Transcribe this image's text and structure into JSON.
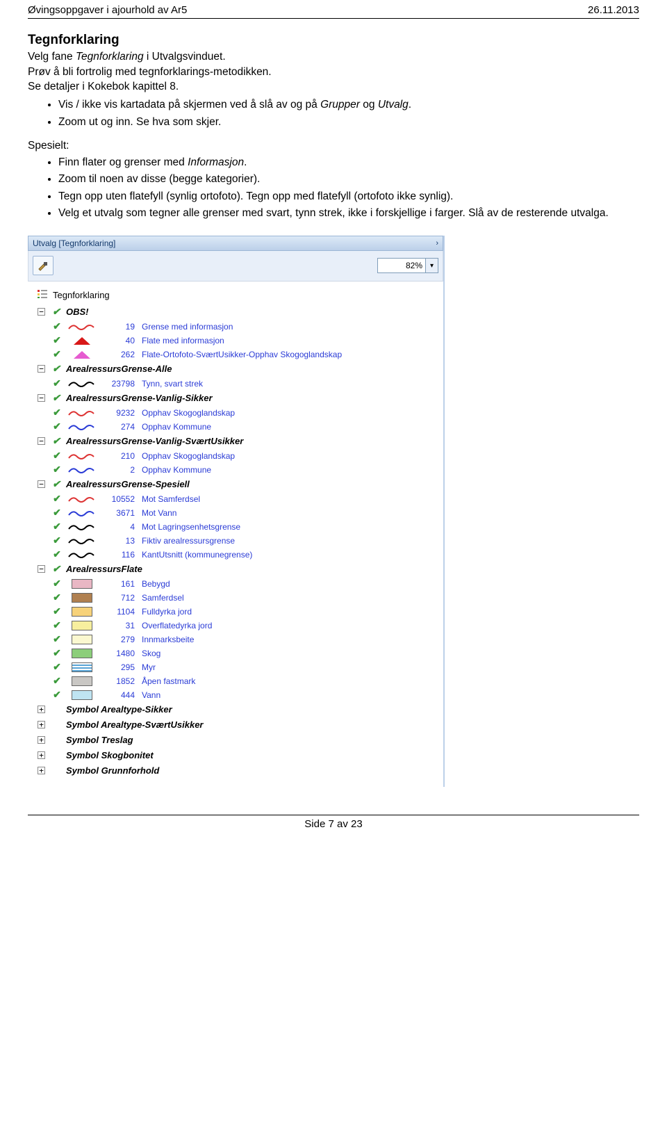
{
  "header": {
    "left": "Øvingsoppgaver i ajourhold av Ar5",
    "right": "26.11.2013"
  },
  "section": {
    "title": "Tegnforklaring",
    "line1_a": "Velg fane ",
    "line1_i": "Tegnforklaring",
    "line1_b": " i Utvalgsvinduet.",
    "line2": "Prøv å bli fortrolig med tegnforklarings-metodikken.",
    "line3": "Se detaljer i Kokebok kapittel 8."
  },
  "bullets1": {
    "b1_a": "Vis / ikke vis kartadata på skjermen ved å slå av og på ",
    "b1_i": "Grupper",
    "b1_b": " og ",
    "b1_i2": "Utvalg",
    "b1_c": ".",
    "b2": "Zoom ut og inn. Se hva som skjer."
  },
  "spesielt": "Spesielt:",
  "bullets2": {
    "b1_a": "Finn flater og grenser med ",
    "b1_i": "Informasjon",
    "b1_b": ".",
    "b2": "Zoom til noen av disse (begge kategorier).",
    "b3": "Tegn opp uten flatefyll (synlig ortofoto). Tegn opp med flatefyll (ortofoto ikke synlig).",
    "b4": "Velg et utvalg som tegner alle grenser med svart, tynn strek, ikke i forskjellige i farger. Slå av de resterende utvalga."
  },
  "ui": {
    "window_title": "Utvalg [Tegnforklaring]",
    "zoom": "82%",
    "legend_label": "Tegnforklaring",
    "groups": [
      {
        "name": "OBS!",
        "toggle": "−",
        "items": [
          {
            "num": "19",
            "label": "Grense med informasjon",
            "sym": {
              "type": "wave",
              "color": "#d33"
            }
          },
          {
            "num": "40",
            "label": "Flate med informasjon",
            "sym": {
              "type": "tri",
              "color": "#d81818"
            }
          },
          {
            "num": "262",
            "label": "Flate-Ortofoto-SværtUsikker-Opphav Skogoglandskap",
            "sym": {
              "type": "tri",
              "color": "#e65bd0"
            }
          }
        ]
      },
      {
        "name": "ArealressursGrense-Alle",
        "toggle": "−",
        "items": [
          {
            "num": "23798",
            "label": "Tynn, svart strek",
            "sym": {
              "type": "wave",
              "color": "#000"
            }
          }
        ]
      },
      {
        "name": "ArealressursGrense-Vanlig-Sikker",
        "toggle": "−",
        "items": [
          {
            "num": "9232",
            "label": "Opphav Skogoglandskap",
            "sym": {
              "type": "wave",
              "color": "#d33"
            }
          },
          {
            "num": "274",
            "label": "Opphav Kommune",
            "sym": {
              "type": "wave",
              "color": "#2a3bd6"
            }
          }
        ]
      },
      {
        "name": "ArealressursGrense-Vanlig-SværtUsikker",
        "toggle": "−",
        "items": [
          {
            "num": "210",
            "label": "Opphav Skogoglandskap",
            "sym": {
              "type": "wave",
              "color": "#d33"
            }
          },
          {
            "num": "2",
            "label": "Opphav Kommune",
            "sym": {
              "type": "wave",
              "color": "#2a3bd6"
            }
          }
        ]
      },
      {
        "name": "ArealressursGrense-Spesiell",
        "toggle": "−",
        "items": [
          {
            "num": "10552",
            "label": "Mot Samferdsel",
            "sym": {
              "type": "wave",
              "color": "#d33"
            }
          },
          {
            "num": "3671",
            "label": "Mot Vann",
            "sym": {
              "type": "wave",
              "color": "#2a3bd6"
            }
          },
          {
            "num": "4",
            "label": "Mot Lagringsenhetsgrense",
            "sym": {
              "type": "wave",
              "color": "#000"
            }
          },
          {
            "num": "13",
            "label": "Fiktiv arealressursgrense",
            "sym": {
              "type": "wave",
              "color": "#000"
            }
          },
          {
            "num": "116",
            "label": "KantUtsnitt (kommunegrense)",
            "sym": {
              "type": "wave",
              "color": "#000"
            }
          }
        ]
      },
      {
        "name": "ArealressursFlate",
        "toggle": "−",
        "items": [
          {
            "num": "161",
            "label": "Bebygd",
            "sym": {
              "type": "box",
              "color": "#e9b7c4"
            }
          },
          {
            "num": "712",
            "label": "Samferdsel",
            "sym": {
              "type": "box",
              "color": "#b08050"
            }
          },
          {
            "num": "1104",
            "label": "Fulldyrka jord",
            "sym": {
              "type": "box",
              "color": "#f7d27a"
            }
          },
          {
            "num": "31",
            "label": "Overflatedyrka jord",
            "sym": {
              "type": "box",
              "color": "#f7ef9e"
            }
          },
          {
            "num": "279",
            "label": "Innmarksbeite",
            "sym": {
              "type": "box",
              "color": "#fbf8d0"
            }
          },
          {
            "num": "1480",
            "label": "Skog",
            "sym": {
              "type": "box",
              "color": "#8cce7a"
            }
          },
          {
            "num": "295",
            "label": "Myr",
            "sym": {
              "type": "stripes",
              "color": ""
            }
          },
          {
            "num": "1852",
            "label": "Åpen fastmark",
            "sym": {
              "type": "box",
              "color": "#c9c7c4"
            }
          },
          {
            "num": "444",
            "label": "Vann",
            "sym": {
              "type": "box",
              "color": "#bfe4f2"
            }
          }
        ]
      },
      {
        "name": "Symbol Arealtype-Sikker",
        "toggle": "+",
        "items": []
      },
      {
        "name": "Symbol Arealtype-SværtUsikker",
        "toggle": "+",
        "items": []
      },
      {
        "name": "Symbol Treslag",
        "toggle": "+",
        "items": []
      },
      {
        "name": "Symbol Skogbonitet",
        "toggle": "+",
        "items": []
      },
      {
        "name": "Symbol Grunnforhold",
        "toggle": "+",
        "items": []
      }
    ]
  },
  "footer": "Side 7 av 23"
}
